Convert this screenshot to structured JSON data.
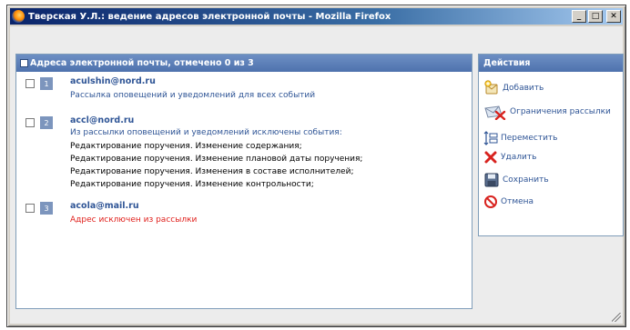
{
  "window": {
    "title": "Тверская У.Л.: ведение адресов электронной почты - Mozilla Firefox",
    "minimize": "_",
    "maximize": "□",
    "close": "✕"
  },
  "addresses": {
    "header": "Адреса электронной почты, отмечено 0 из 3",
    "items": [
      {
        "index": "1",
        "email": "aculshin@nord.ru",
        "note": "Рассылка оповещений и уведомлений для всех событий",
        "note_color": "#2f5596",
        "excluded_events": []
      },
      {
        "index": "2",
        "email": "accl@nord.ru",
        "note": "Из рассылки оповещений и уведомлений исключены события:",
        "note_color": "#2f5596",
        "excluded_events": [
          "Редактирование поручения. Изменение содержания;",
          "Редактирование поручения. Изменение плановой даты поручения;",
          "Редактирование поручения. Изменения в составе исполнителей;",
          "Редактирование поручения. Изменение контрольности;"
        ]
      },
      {
        "index": "3",
        "email": "acola@mail.ru",
        "note": "Адрес исключен из рассылки",
        "note_color": "#e0201c",
        "excluded_events": []
      }
    ]
  },
  "actions": {
    "header": "Действия",
    "items": [
      {
        "label": "Добавить",
        "icon": "add-icon"
      },
      {
        "label": "Ограничения рассылки",
        "icon": "mail-restrict-icon"
      },
      {
        "label": "Переместить",
        "icon": "move-icon"
      },
      {
        "label": "Удалить",
        "icon": "delete-icon"
      },
      {
        "label": "Сохранить",
        "icon": "save-icon"
      },
      {
        "label": "Отмена",
        "icon": "cancel-icon"
      }
    ]
  }
}
